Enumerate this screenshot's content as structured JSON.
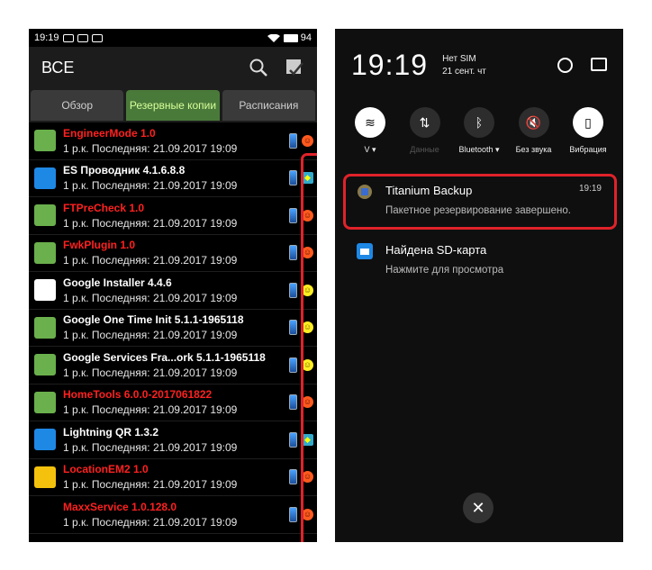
{
  "left": {
    "status": {
      "time": "19:19",
      "battery": "94"
    },
    "appbar": {
      "title": "ВСЕ"
    },
    "tabs": [
      {
        "label": "Обзор",
        "active": false
      },
      {
        "label": "Резервные копии",
        "active": true
      },
      {
        "label": "Расписания",
        "active": false
      }
    ],
    "apps": [
      {
        "name": "EngineerMode 1.0",
        "sub": "1 р.к. Последняя: 21.09.2017 19:09",
        "red": true,
        "badge": "red"
      },
      {
        "name": "ES Проводник 4.1.6.8.8",
        "sub": "1 р.к. Последняя: 21.09.2017 19:09",
        "red": false,
        "badge": "shield"
      },
      {
        "name": "FTPreCheck 1.0",
        "sub": "1 р.к. Последняя: 21.09.2017 19:09",
        "red": true,
        "badge": "red"
      },
      {
        "name": "FwkPlugin 1.0",
        "sub": "1 р.к. Последняя: 21.09.2017 19:09",
        "red": true,
        "badge": "red"
      },
      {
        "name": "Google Installer 4.4.6",
        "sub": "1 р.к. Последняя: 21.09.2017 19:09",
        "red": false,
        "badge": "yellow"
      },
      {
        "name": "Google One Time Init 5.1.1-1965118",
        "sub": "1 р.к. Последняя: 21.09.2017 19:09",
        "red": false,
        "badge": "yellow"
      },
      {
        "name": "Google Services Fra...ork 5.1.1-1965118",
        "sub": "1 р.к. Последняя: 21.09.2017 19:09",
        "red": false,
        "badge": "yellow"
      },
      {
        "name": "HomeTools 6.0.0-2017061822",
        "sub": "1 р.к. Последняя: 21.09.2017 19:09",
        "red": true,
        "badge": "red"
      },
      {
        "name": "Lightning QR 1.3.2",
        "sub": "1 р.к. Последняя: 21.09.2017 19:09",
        "red": false,
        "badge": "shield"
      },
      {
        "name": "LocationEM2 1.0",
        "sub": "1 р.к. Последняя: 21.09.2017 19:09",
        "red": true,
        "badge": "red"
      },
      {
        "name": "MaxxService 1.0.128.0",
        "sub": "1 р.к. Последняя: 21.09.2017 19:09",
        "red": true,
        "badge": "red"
      }
    ]
  },
  "right": {
    "time": "19:19",
    "sim": "Нет SIM",
    "date": "21 сент. чт",
    "quick": [
      {
        "label": "V ▾",
        "on": true,
        "icon": "wifi-icon",
        "glyph": "≋"
      },
      {
        "label": "Данные",
        "on": false,
        "icon": "data-icon",
        "glyph": "⇅"
      },
      {
        "label": "Bluetooth ▾",
        "on": false,
        "icon": "bluetooth-icon",
        "glyph": "ᛒ"
      },
      {
        "label": "Без звука",
        "on": false,
        "icon": "mute-icon",
        "glyph": "🔇"
      },
      {
        "label": "Вибрация",
        "on": true,
        "icon": "vibration-icon",
        "glyph": "▯"
      }
    ],
    "notifications": [
      {
        "title": "Titanium Backup",
        "time": "19:19",
        "text": "Пакетное резервирование завершено."
      },
      {
        "title": "Найдена SD-карта",
        "time": "",
        "text": "Нажмите для просмотра"
      }
    ],
    "close": "✕"
  }
}
